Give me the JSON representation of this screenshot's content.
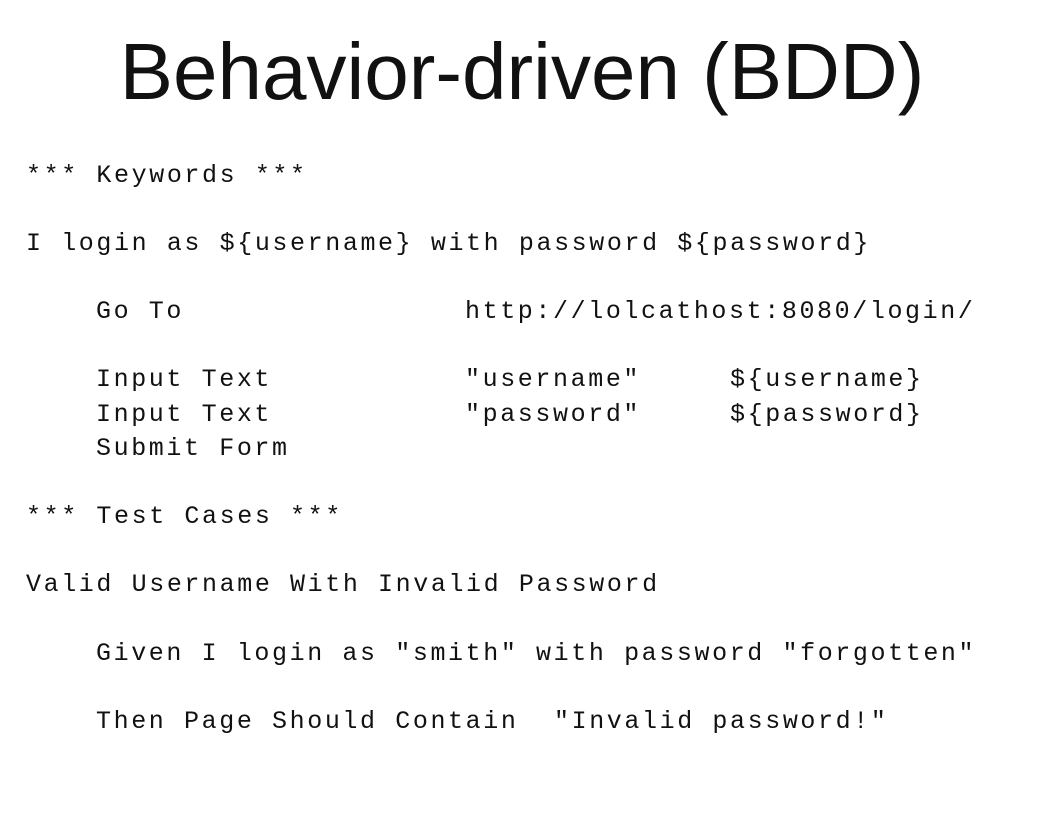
{
  "title": "Behavior-driven (BDD)",
  "keywords_header": "*** Keywords ***",
  "keyword_name": "I login as ${username} with password ${password}",
  "steps": {
    "goto": {
      "kw": "Go To",
      "arg1": "http://lolcathost:8080/login/"
    },
    "input_username": {
      "kw": "Input Text",
      "arg1": "\"username\"",
      "arg2": "${username}"
    },
    "input_password": {
      "kw": "Input Text",
      "arg1": "\"password\"",
      "arg2": "${password}"
    },
    "submit": {
      "kw": "Submit Form"
    }
  },
  "testcases_header": "*** Test Cases ***",
  "testcase_name": "Valid Username With Invalid Password",
  "given_step": "Given I login as \"smith\" with password \"forgotten\"",
  "then_step": {
    "kw": "Then Page Should Contain",
    "arg1": "\"Invalid password!\""
  }
}
